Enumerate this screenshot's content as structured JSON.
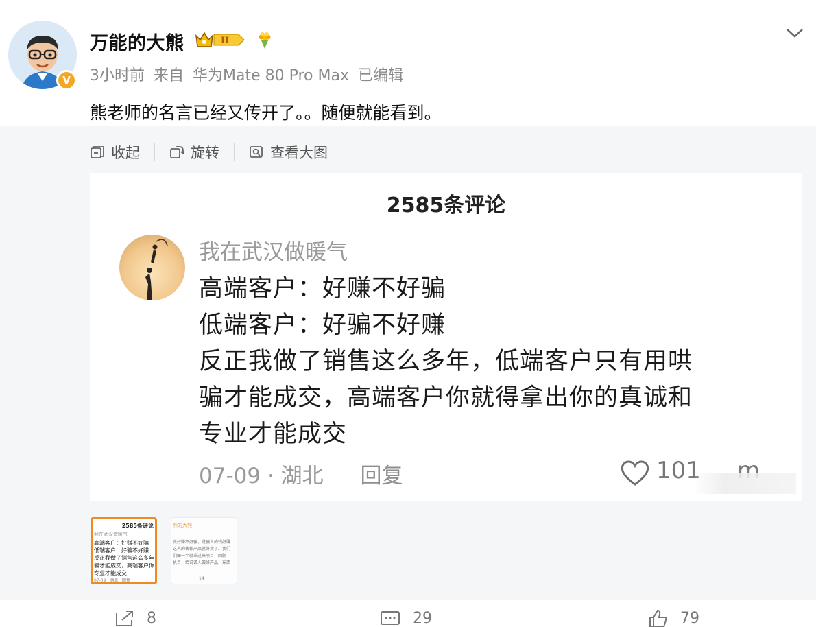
{
  "post": {
    "username": "万能的大熊",
    "vip_level": "II",
    "verified_badge": "V",
    "time": "3小时前",
    "source_prefix": "来自",
    "device": "华为Mate 80 Pro Max",
    "edited": "已编辑",
    "text": "熊老师的名言已经又传开了。。随便就能看到。"
  },
  "media_toolbar": {
    "collapse": "收起",
    "rotate": "旋转",
    "view_large": "查看大图"
  },
  "image": {
    "title": "2585条评论",
    "commenter": "我在武汉做暖气",
    "lines": [
      "高端客户：好赚不好骗",
      "低端客户：好骗不好赚",
      "反正我做了销售这么多年，低端客户只有用哄",
      "骗才能成交，高端客户你就得拿出你的真诚和",
      "专业才能成交"
    ],
    "date": "07-09",
    "dot": "·",
    "location": "湖北",
    "reply": "回复",
    "likes": "101",
    "more": "m"
  },
  "thumbnails": {
    "t1": {
      "title": "2585条评论",
      "name": "我在武汉做暖气",
      "lines": [
        "高端客户：好赚不好骗",
        "低端客户：好骗不好赚",
        "反正我做了销售这么多年",
        "骗才能成交，高端客户你",
        "专业才能成交"
      ],
      "meta": "07-09 · 湖北 · 回复"
    },
    "t2": {
      "head": "熊的大熊",
      "lines": [
        "说好赚不好骗，说骗人的钱好赚",
        "这人的钱都产品就好卖了。我们",
        "们面一个就拿过来项目，回顾",
        "执目，给说谎人做好产品、东西"
      ],
      "meta": "14"
    }
  },
  "actions": {
    "share": "8",
    "comment": "29",
    "like": "79"
  },
  "colors": {
    "accent_orange": "#ee8a1f",
    "vip_gold": "#f5b90a",
    "meta_gray": "#8a8a8a",
    "panel_bg": "#f5f6f8"
  }
}
